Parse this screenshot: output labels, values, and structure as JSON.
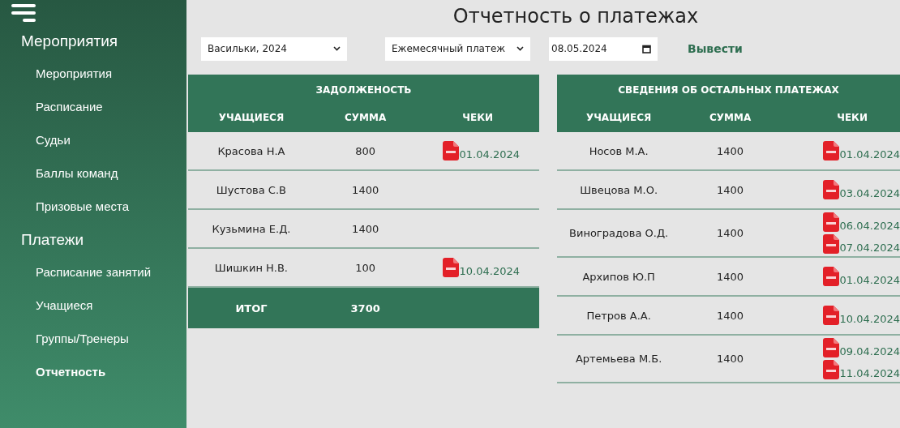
{
  "sidebar": {
    "groups": [
      {
        "title": "Мероприятия",
        "items": [
          {
            "label": "Мероприятия",
            "selected": false
          },
          {
            "label": "Расписание",
            "selected": false
          },
          {
            "label": "Судьи",
            "selected": false
          },
          {
            "label": "Баллы команд",
            "selected": false
          },
          {
            "label": "Призовые места",
            "selected": false
          }
        ]
      },
      {
        "title": "Платежи",
        "items": [
          {
            "label": "Расписание занятий",
            "selected": false
          },
          {
            "label": "Учащиеся",
            "selected": false
          },
          {
            "label": "Группы/Тренеры",
            "selected": false
          },
          {
            "label": "Отчетность",
            "selected": true
          }
        ]
      }
    ]
  },
  "title": "Отчетность о платежах",
  "filters": {
    "event": "Васильки, 2024",
    "payment_type": "Ежемесячный платеж",
    "date": "08.05.2024",
    "submit": "Вывести"
  },
  "debt_table": {
    "title": "ЗАДОЛЖЕНОСТЬ",
    "columns": [
      "УЧАЩИЕСЯ",
      "СУММА",
      "ЧЕКИ"
    ],
    "rows": [
      {
        "student": "Красова Н.А",
        "amount": "800",
        "receipts": [
          "01.04.2024"
        ]
      },
      {
        "student": "Шустова С.В",
        "amount": "1400",
        "receipts": []
      },
      {
        "student": "Кузьмина Е.Д.",
        "amount": "1400",
        "receipts": []
      },
      {
        "student": "Шишкин Н.В.",
        "amount": "100",
        "receipts": [
          "10.04.2024"
        ]
      }
    ],
    "total": {
      "label": "ИТОГ",
      "amount": "3700"
    }
  },
  "other_table": {
    "title": "СВЕДЕНИЯ ОБ ОСТАЛЬНЫХ ПЛАТЕЖАХ",
    "columns": [
      "УЧАЩИЕСЯ",
      "СУММА",
      "ЧЕКИ"
    ],
    "rows": [
      {
        "student": "Носов М.А.",
        "amount": "1400",
        "receipts": [
          "01.04.2024"
        ]
      },
      {
        "student": "Швецова М.О.",
        "amount": "1400",
        "receipts": [
          "03.04.2024"
        ]
      },
      {
        "student": "Виноградова О.Д.",
        "amount": "1400",
        "receipts": [
          "06.04.2024",
          "07.04.2024"
        ]
      },
      {
        "student": "Архипов Ю.П",
        "amount": "1400",
        "receipts": [
          "01.04.2024"
        ]
      },
      {
        "student": "Петров А.А.",
        "amount": "1400",
        "receipts": [
          "10.04.2024"
        ]
      },
      {
        "student": "Артемьева М.Б.",
        "amount": "1400",
        "receipts": [
          "09.04.2024",
          "11.04.2024"
        ]
      }
    ]
  }
}
